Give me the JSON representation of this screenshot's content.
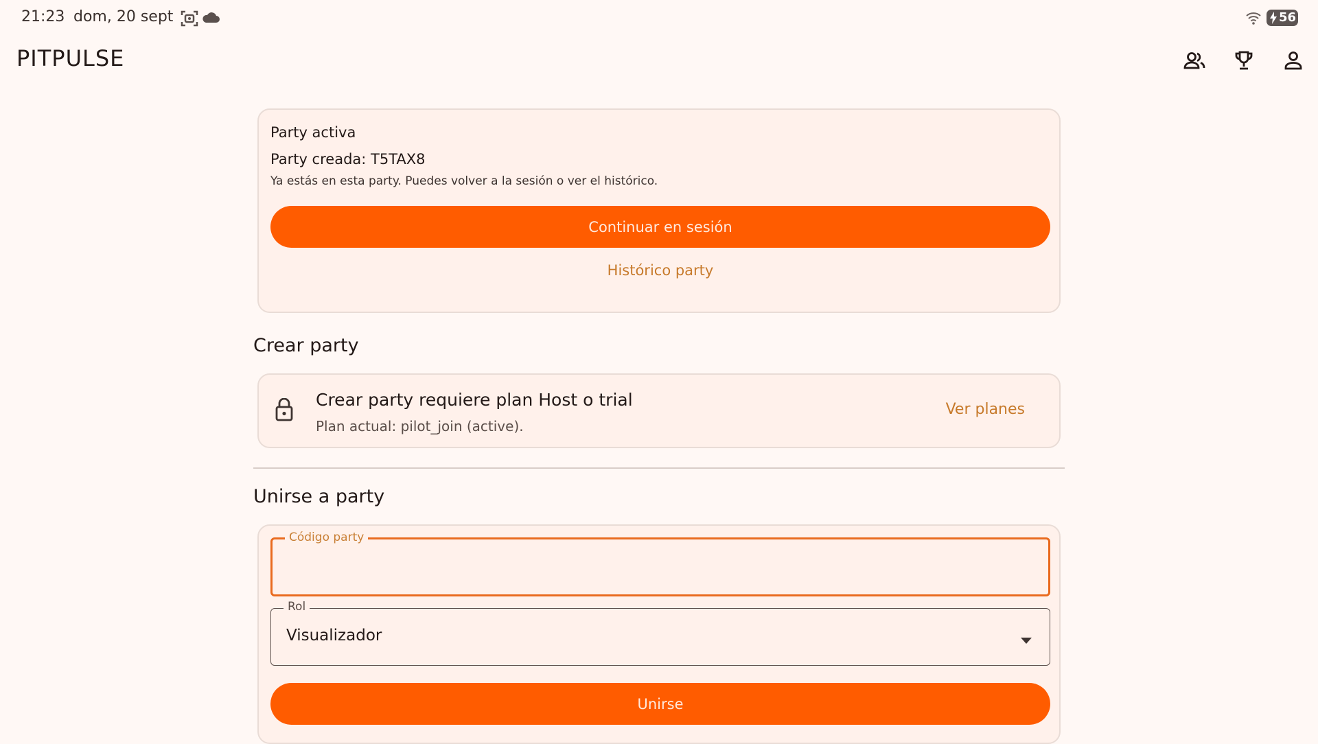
{
  "status": {
    "time": "21:23",
    "date": "dom, 20 sept",
    "battery": "56",
    "icons": [
      "screenshot-icon",
      "cloud-icon",
      "wifi-icon",
      "battery-icon"
    ]
  },
  "app": {
    "title": "PITPULSE",
    "actions": [
      "group-icon",
      "trophy-icon",
      "person-icon"
    ]
  },
  "active_party": {
    "heading": "Party activa",
    "created": "Party creada: T5TAX8",
    "helper": "Ya estás en esta party. Puedes volver a la sesión o ver el histórico.",
    "continue_label": "Continuar en sesión",
    "history_label": "Histórico party"
  },
  "create_party": {
    "section_title": "Crear party",
    "locked_title": "Crear party requiere plan Host o trial",
    "locked_subtitle": "Plan actual: pilot_join (active).",
    "plans_label": "Ver planes"
  },
  "join_party": {
    "section_title": "Unirse a party",
    "code_label": "Código party",
    "code_value": "",
    "role_label": "Rol",
    "role_value": "Visualizador",
    "submit_label": "Unirse"
  },
  "colors": {
    "background": "#FFF8F5",
    "primary": "#FF5C00",
    "accent_text": "#C77A2B",
    "card": "#FFF1EB"
  }
}
